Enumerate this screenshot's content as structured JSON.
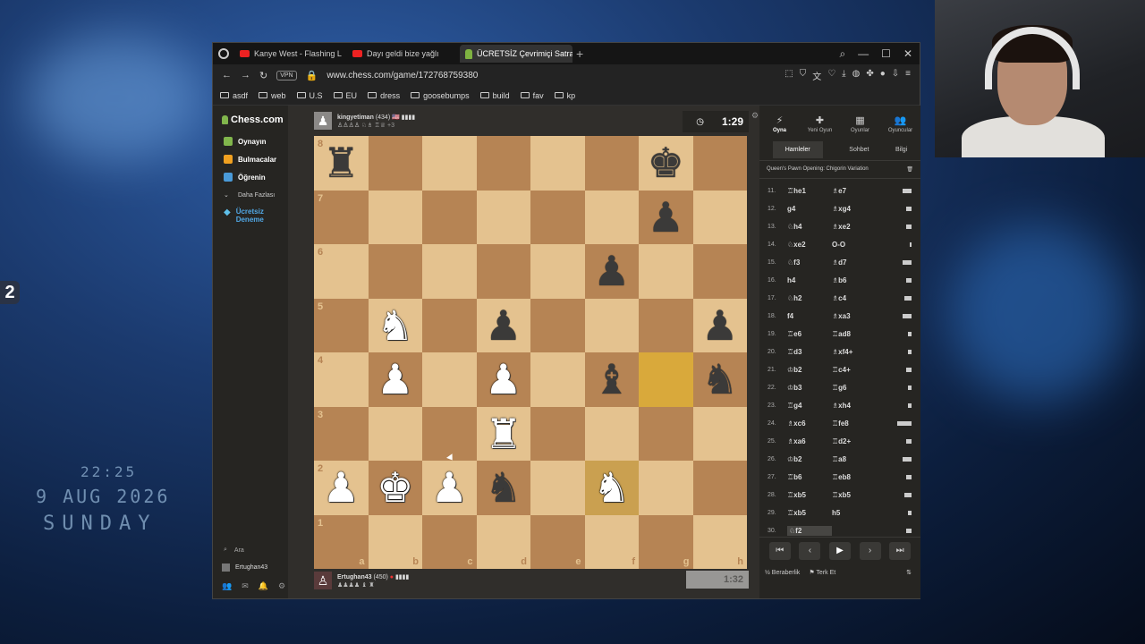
{
  "desktop": {
    "badge": "2",
    "clock_time": "22:25",
    "clock_date": "9 AUG 2026",
    "clock_day": "SUNDAY"
  },
  "browser": {
    "tabs": [
      {
        "label": "Kanye West - Flashing L",
        "icon": "youtube-icon"
      },
      {
        "label": "Dayı geldi bize yağlı",
        "icon": "youtube-icon"
      },
      {
        "label": "ÜCRETSİZ Çevrimiçi Satran",
        "icon": "chess-pawn-icon",
        "active": true
      }
    ],
    "vpn_label": "VPN",
    "url": "www.chess.com/game/172768759380",
    "bookmarks": [
      "asdf",
      "web",
      "U.S",
      "EU",
      "dress",
      "goosebumps",
      "build",
      "fav",
      "kp"
    ]
  },
  "nav": {
    "logo": "Chess.com",
    "items": [
      {
        "label": "Oynayın",
        "color": "#81b64c"
      },
      {
        "label": "Bulmacalar",
        "color": "#f0a020"
      },
      {
        "label": "Öğrenin",
        "color": "#4a9ad8"
      },
      {
        "label": "Daha Fazlası",
        "color": "#888888"
      }
    ],
    "trial_line1": "Ücretsiz",
    "trial_line2": "Deneme",
    "search_label": "Ara",
    "username": "Ertughan43"
  },
  "game": {
    "top_player": {
      "name": "kingyetiman",
      "rating": "(434)",
      "captured": "♙♙♙♙ ♘♗ ♖♕",
      "captured_extra": "+3",
      "clock": "1:29"
    },
    "bottom_player": {
      "name": "Ertughan43",
      "rating": "(450)",
      "captured": "♟♟♟♟ ♝ ♜",
      "clock": "1:32"
    },
    "ranks": [
      "8",
      "7",
      "6",
      "5",
      "4",
      "3",
      "2",
      "1"
    ],
    "files": [
      "a",
      "b",
      "c",
      "d",
      "e",
      "f",
      "g",
      "h"
    ],
    "board": [
      [
        "r",
        "",
        "",
        "",
        "",
        "",
        "k",
        ""
      ],
      [
        "",
        "",
        "",
        "",
        "",
        "",
        "p",
        ""
      ],
      [
        "",
        "",
        "",
        "",
        "",
        "p",
        "",
        ""
      ],
      [
        "",
        "N",
        "",
        "p",
        "",
        "",
        "",
        "p"
      ],
      [
        "",
        "P",
        "",
        "P",
        "",
        "b",
        "",
        "n"
      ],
      [
        "",
        "",
        "",
        "R",
        "",
        "",
        "",
        ""
      ],
      [
        "P",
        "K",
        "P",
        "n",
        "",
        "N",
        "",
        ""
      ],
      [
        "",
        "",
        "",
        "",
        "",
        "",
        "",
        ""
      ]
    ],
    "highlight": [
      "g4",
      "f2"
    ]
  },
  "panel": {
    "tabs": [
      {
        "label": "Oyna",
        "glyph": "⚡",
        "active": true
      },
      {
        "label": "Yeni Oyun",
        "glyph": "✚"
      },
      {
        "label": "Oyunlar",
        "glyph": "▦"
      },
      {
        "label": "Oyuncular",
        "glyph": "👥"
      }
    ],
    "subtabs": [
      "Hamleler",
      "Sohbet",
      "Bilgi"
    ],
    "opening": "Queen's Pawn Opening: Chigorin Variation",
    "moves": [
      {
        "n": "11.",
        "w": "♖he1",
        "b": "♗e7",
        "bar": 10
      },
      {
        "n": "12.",
        "w": "g4",
        "b": "♗xg4",
        "bar": 6
      },
      {
        "n": "13.",
        "w": "♘h4",
        "b": "♗xe2",
        "bar": 6
      },
      {
        "n": "14.",
        "w": "♘xe2",
        "b": "O-O",
        "bar": 2
      },
      {
        "n": "15.",
        "w": "♘f3",
        "b": "♗d7",
        "bar": 10
      },
      {
        "n": "16.",
        "w": "h4",
        "b": "♗b6",
        "bar": 6
      },
      {
        "n": "17.",
        "w": "♘h2",
        "b": "♗c4",
        "bar": 8
      },
      {
        "n": "18.",
        "w": "f4",
        "b": "♗xa3",
        "bar": 10
      },
      {
        "n": "19.",
        "w": "♖e6",
        "b": "♖ad8",
        "bar": 4
      },
      {
        "n": "20.",
        "w": "♖d3",
        "b": "♗xf4+",
        "bar": 4
      },
      {
        "n": "21.",
        "w": "♔b2",
        "b": "♖c4+",
        "bar": 6
      },
      {
        "n": "22.",
        "w": "♔b3",
        "b": "♖g6",
        "bar": 4
      },
      {
        "n": "23.",
        "w": "♖g4",
        "b": "♗xh4",
        "bar": 4
      },
      {
        "n": "24.",
        "w": "♗xc6",
        "b": "♖fe8",
        "bar": 16
      },
      {
        "n": "25.",
        "w": "♗xa6",
        "b": "♖d2+",
        "bar": 6
      },
      {
        "n": "26.",
        "w": "♔b2",
        "b": "♖a8",
        "bar": 10
      },
      {
        "n": "27.",
        "w": "♖b6",
        "b": "♖eb8",
        "bar": 6
      },
      {
        "n": "28.",
        "w": "♖xb5",
        "b": "♖xb5",
        "bar": 8
      },
      {
        "n": "29.",
        "w": "♖xb5",
        "b": "h5",
        "bar": 4
      },
      {
        "n": "30.",
        "w": "♘f2",
        "b": "",
        "bar": 6
      }
    ],
    "draw_label": "Beraberlik",
    "resign_label": "Terk Et"
  }
}
